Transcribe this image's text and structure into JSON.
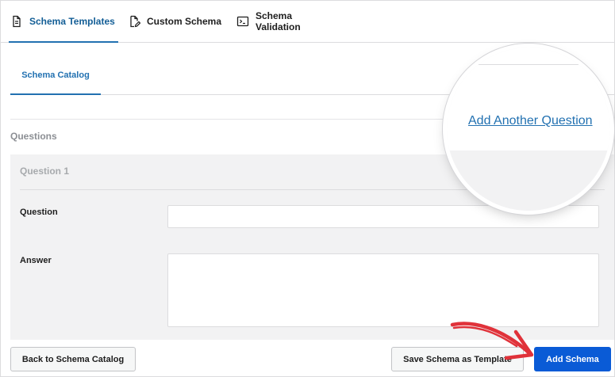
{
  "top_tabs": [
    {
      "label": "Schema Templates",
      "icon": "document-icon",
      "active": true
    },
    {
      "label": "Custom Schema",
      "icon": "edit-document-icon",
      "active": false
    },
    {
      "label": "Schema Validation",
      "icon": "terminal-icon",
      "active": false
    }
  ],
  "sub_tabs": [
    {
      "label": "Schema Catalog",
      "active": true
    }
  ],
  "questions": {
    "title": "Questions",
    "items": [
      {
        "title": "Question 1",
        "question_label": "Question",
        "question_value": "",
        "answer_label": "Answer",
        "answer_value": ""
      }
    ]
  },
  "magnifier": {
    "link": "Add Another Question"
  },
  "buttons": {
    "back": "Back to Schema Catalog",
    "save_template": "Save Schema as Template",
    "add": "Add Schema"
  },
  "colors": {
    "accent": "#2271b1",
    "primary_button": "#0a5bd6",
    "arrow": "#e0323a"
  }
}
